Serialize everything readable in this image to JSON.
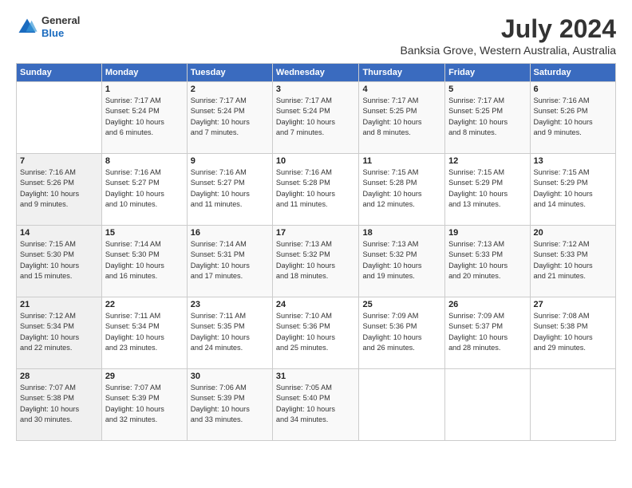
{
  "logo": {
    "general": "General",
    "blue": "Blue"
  },
  "title": "July 2024",
  "subtitle": "Banksia Grove, Western Australia, Australia",
  "days": [
    "Sunday",
    "Monday",
    "Tuesday",
    "Wednesday",
    "Thursday",
    "Friday",
    "Saturday"
  ],
  "weeks": [
    [
      {
        "date": "",
        "info": ""
      },
      {
        "date": "1",
        "info": "Sunrise: 7:17 AM\nSunset: 5:24 PM\nDaylight: 10 hours\nand 6 minutes."
      },
      {
        "date": "2",
        "info": "Sunrise: 7:17 AM\nSunset: 5:24 PM\nDaylight: 10 hours\nand 7 minutes."
      },
      {
        "date": "3",
        "info": "Sunrise: 7:17 AM\nSunset: 5:24 PM\nDaylight: 10 hours\nand 7 minutes."
      },
      {
        "date": "4",
        "info": "Sunrise: 7:17 AM\nSunset: 5:25 PM\nDaylight: 10 hours\nand 8 minutes."
      },
      {
        "date": "5",
        "info": "Sunrise: 7:17 AM\nSunset: 5:25 PM\nDaylight: 10 hours\nand 8 minutes."
      },
      {
        "date": "6",
        "info": "Sunrise: 7:16 AM\nSunset: 5:26 PM\nDaylight: 10 hours\nand 9 minutes."
      }
    ],
    [
      {
        "date": "7",
        "info": "Sunrise: 7:16 AM\nSunset: 5:26 PM\nDaylight: 10 hours\nand 9 minutes."
      },
      {
        "date": "8",
        "info": "Sunrise: 7:16 AM\nSunset: 5:27 PM\nDaylight: 10 hours\nand 10 minutes."
      },
      {
        "date": "9",
        "info": "Sunrise: 7:16 AM\nSunset: 5:27 PM\nDaylight: 10 hours\nand 11 minutes."
      },
      {
        "date": "10",
        "info": "Sunrise: 7:16 AM\nSunset: 5:28 PM\nDaylight: 10 hours\nand 11 minutes."
      },
      {
        "date": "11",
        "info": "Sunrise: 7:15 AM\nSunset: 5:28 PM\nDaylight: 10 hours\nand 12 minutes."
      },
      {
        "date": "12",
        "info": "Sunrise: 7:15 AM\nSunset: 5:29 PM\nDaylight: 10 hours\nand 13 minutes."
      },
      {
        "date": "13",
        "info": "Sunrise: 7:15 AM\nSunset: 5:29 PM\nDaylight: 10 hours\nand 14 minutes."
      }
    ],
    [
      {
        "date": "14",
        "info": "Sunrise: 7:15 AM\nSunset: 5:30 PM\nDaylight: 10 hours\nand 15 minutes."
      },
      {
        "date": "15",
        "info": "Sunrise: 7:14 AM\nSunset: 5:30 PM\nDaylight: 10 hours\nand 16 minutes."
      },
      {
        "date": "16",
        "info": "Sunrise: 7:14 AM\nSunset: 5:31 PM\nDaylight: 10 hours\nand 17 minutes."
      },
      {
        "date": "17",
        "info": "Sunrise: 7:13 AM\nSunset: 5:32 PM\nDaylight: 10 hours\nand 18 minutes."
      },
      {
        "date": "18",
        "info": "Sunrise: 7:13 AM\nSunset: 5:32 PM\nDaylight: 10 hours\nand 19 minutes."
      },
      {
        "date": "19",
        "info": "Sunrise: 7:13 AM\nSunset: 5:33 PM\nDaylight: 10 hours\nand 20 minutes."
      },
      {
        "date": "20",
        "info": "Sunrise: 7:12 AM\nSunset: 5:33 PM\nDaylight: 10 hours\nand 21 minutes."
      }
    ],
    [
      {
        "date": "21",
        "info": "Sunrise: 7:12 AM\nSunset: 5:34 PM\nDaylight: 10 hours\nand 22 minutes."
      },
      {
        "date": "22",
        "info": "Sunrise: 7:11 AM\nSunset: 5:34 PM\nDaylight: 10 hours\nand 23 minutes."
      },
      {
        "date": "23",
        "info": "Sunrise: 7:11 AM\nSunset: 5:35 PM\nDaylight: 10 hours\nand 24 minutes."
      },
      {
        "date": "24",
        "info": "Sunrise: 7:10 AM\nSunset: 5:36 PM\nDaylight: 10 hours\nand 25 minutes."
      },
      {
        "date": "25",
        "info": "Sunrise: 7:09 AM\nSunset: 5:36 PM\nDaylight: 10 hours\nand 26 minutes."
      },
      {
        "date": "26",
        "info": "Sunrise: 7:09 AM\nSunset: 5:37 PM\nDaylight: 10 hours\nand 28 minutes."
      },
      {
        "date": "27",
        "info": "Sunrise: 7:08 AM\nSunset: 5:38 PM\nDaylight: 10 hours\nand 29 minutes."
      }
    ],
    [
      {
        "date": "28",
        "info": "Sunrise: 7:07 AM\nSunset: 5:38 PM\nDaylight: 10 hours\nand 30 minutes."
      },
      {
        "date": "29",
        "info": "Sunrise: 7:07 AM\nSunset: 5:39 PM\nDaylight: 10 hours\nand 32 minutes."
      },
      {
        "date": "30",
        "info": "Sunrise: 7:06 AM\nSunset: 5:39 PM\nDaylight: 10 hours\nand 33 minutes."
      },
      {
        "date": "31",
        "info": "Sunrise: 7:05 AM\nSunset: 5:40 PM\nDaylight: 10 hours\nand 34 minutes."
      },
      {
        "date": "",
        "info": ""
      },
      {
        "date": "",
        "info": ""
      },
      {
        "date": "",
        "info": ""
      }
    ]
  ]
}
